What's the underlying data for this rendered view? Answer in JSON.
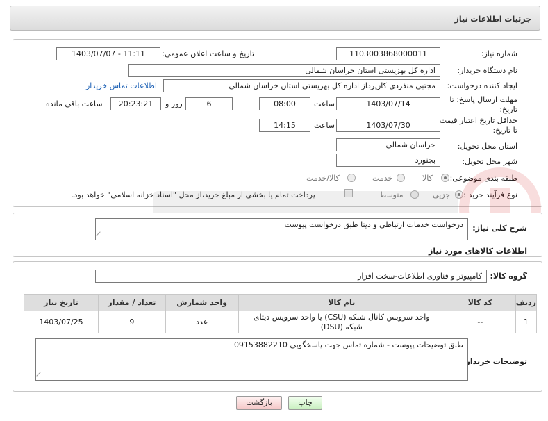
{
  "header": {
    "title": "جزئیات اطلاعات نیاز"
  },
  "form": {
    "need_number_label": "شماره نیاز:",
    "need_number": "1103003868000011",
    "announce_label": "تاریخ و ساعت اعلان عمومی:",
    "announce_value": "1403/07/07 - 11:11",
    "buyer_label": "نام دستگاه خریدار:",
    "buyer_value": "اداره کل بهزیستی استان خراسان شمالی",
    "creator_label": "ایجاد کننده درخواست:",
    "creator_value": "مجتبی منفردی کارپرداز اداره کل بهزیستی استان خراسان شمالی",
    "contact_link": "اطلاعات تماس خریدار",
    "deadline_label": "مهلت ارسال پاسخ: تا تاریخ:",
    "deadline_date": "1403/07/14",
    "time_label": "ساعت",
    "deadline_time": "08:00",
    "days_value": "6",
    "days_label": "روز و",
    "remaining_value": "20:23:21",
    "remaining_label": "ساعت باقی مانده",
    "validity_label": "حداقل تاریخ اعتبار قیمت: تا تاریخ:",
    "validity_date": "1403/07/30",
    "validity_time_label": "ساعت",
    "validity_time": "14:15",
    "province_label": "استان محل تحویل:",
    "province_value": "خراسان شمالی",
    "city_label": "شهر محل تحویل:",
    "city_value": "بجنورد",
    "category_label": "طبقه بندی موضوعی:",
    "category_options": [
      "کالا",
      "خدمت",
      "کالا/خدمت"
    ],
    "process_label": "نوع فرآیند خرید :",
    "process_options": [
      "جزیی",
      "متوسط"
    ],
    "payment_note": "پرداخت تمام یا بخشی از مبلغ خرید،از محل \"اسناد خزانه اسلامی\" خواهد بود."
  },
  "summary": {
    "label": "شرح کلی نیاز:",
    "value": "درخواست خدمات ارتباطی و دیتا طبق درخواست پیوست"
  },
  "goods": {
    "section_title": "اطلاعات کالاهای مورد نیاز",
    "group_label": "گروه کالا:",
    "group_value": "کامپیوتر و فناوری اطلاعات-سخت افزار",
    "columns": [
      "ردیف",
      "کد کالا",
      "نام کالا",
      "واحد شمارش",
      "تعداد / مقدار",
      "تاریخ نیاز"
    ],
    "rows": [
      {
        "row": "1",
        "code": "--",
        "name": "واحد سرویس کانال شبکه (CSU) یا واحد سرویس دیتای شبکه (DSU)",
        "unit": "عدد",
        "qty": "9",
        "date": "1403/07/25"
      }
    ]
  },
  "buyer_notes": {
    "label": "توضیحات خریدار:",
    "value": "طبق توضیحات پیوست - شماره تماس جهت پاسخگویی 09153882210"
  },
  "buttons": {
    "print": "چاپ",
    "back": "بازگشت"
  }
}
